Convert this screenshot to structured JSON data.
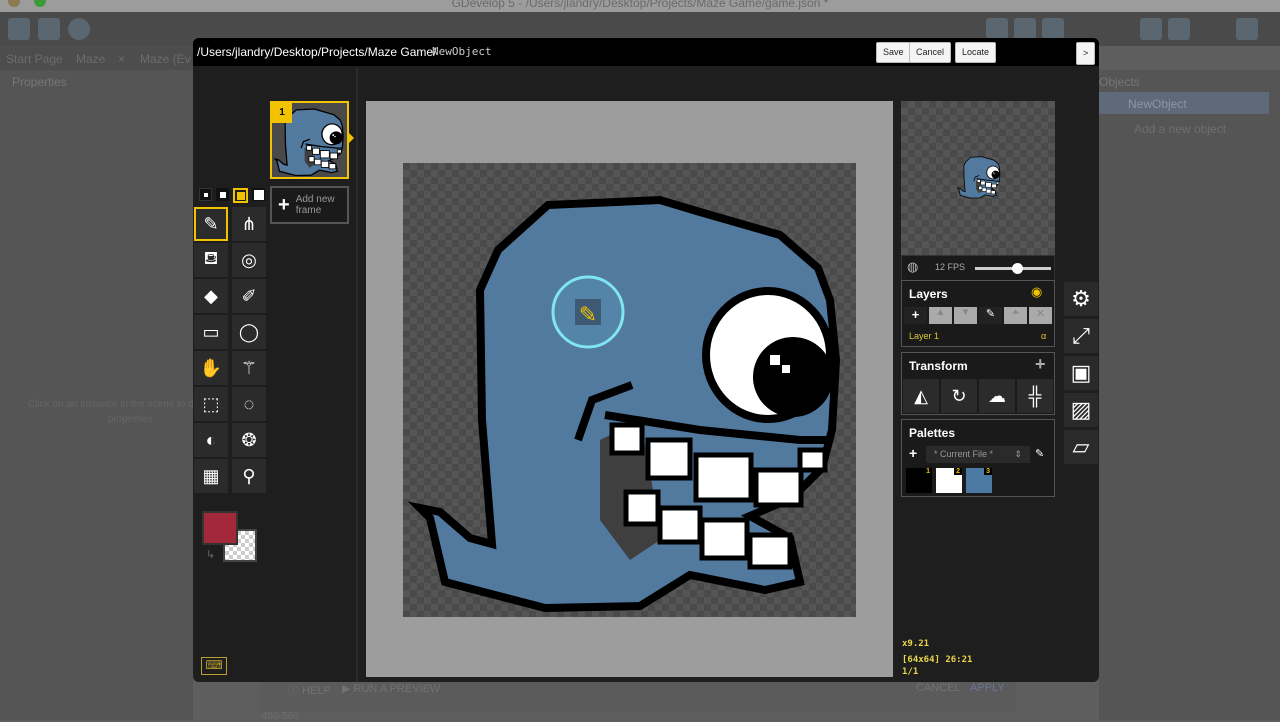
{
  "os": {
    "window_title": "GDevelop 5 - /Users/jlandry/Desktop/Projects/Maze Game/game.json *"
  },
  "ide": {
    "tabs": [
      "Start Page",
      "Maze",
      "Maze (Ev"
    ],
    "properties_title": "Properties",
    "properties_hint": "Click on an instance in the scene to display its properties",
    "objects_title": "Objects",
    "objects": [
      "NewObject"
    ],
    "add_object": "Add a new object",
    "help": "HELP",
    "run_preview": "RUN A PREVIEW",
    "cancel": "CANCEL",
    "apply": "APPLY",
    "status": "460-560"
  },
  "editor": {
    "path": "/Users/jlandry/Desktop/Projects/Maze Game/",
    "object_name": "NewObject",
    "buttons": {
      "save": "Save",
      "cancel": "Cancel",
      "locate": "Locate",
      "expand": ">"
    },
    "frame_number": "1",
    "add_frame": "Add new frame",
    "fps": "12 FPS",
    "fps_slider_fraction": 0.55,
    "layers": {
      "title": "Layers",
      "items": [
        {
          "name": "Layer 1",
          "alpha": "α"
        }
      ]
    },
    "transform": {
      "title": "Transform"
    },
    "palettes": {
      "title": "Palettes",
      "selected": "* Current File *",
      "swatches": [
        {
          "n": "1",
          "color": "#000000"
        },
        {
          "n": "2",
          "color": "#ffffff"
        },
        {
          "n": "3",
          "color": "#4d7aa3"
        }
      ]
    },
    "status": {
      "zoom": "x9.21",
      "size_pos": "[64x64] 26:21",
      "frames": "1/1"
    },
    "colors": {
      "primary": "#a3283a",
      "secondary": "transparent",
      "accent": "#f2c300",
      "body": "#52799e"
    }
  }
}
